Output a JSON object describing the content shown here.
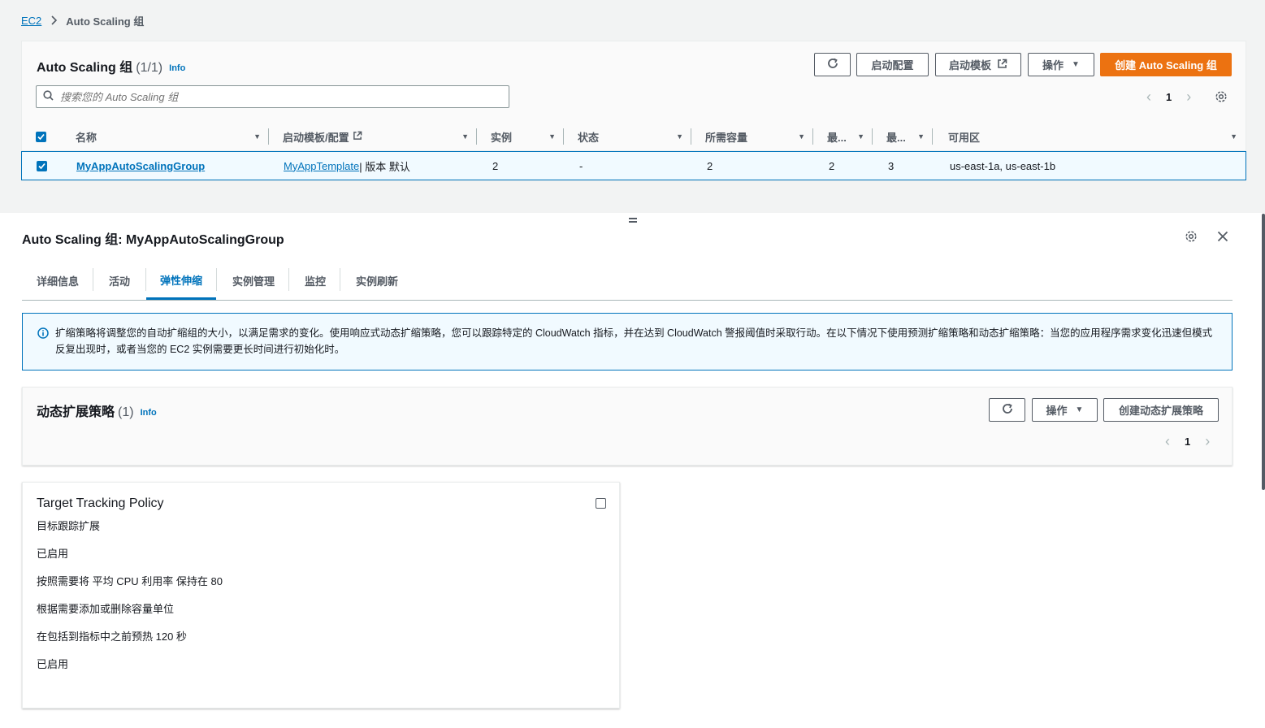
{
  "breadcrumb": {
    "root": "EC2",
    "current": "Auto Scaling 组"
  },
  "asg_panel": {
    "title": "Auto Scaling 组",
    "count": "(1/1)",
    "info": "Info",
    "buttons": {
      "launch_config": "启动配置",
      "launch_template": "启动模板",
      "actions": "操作",
      "create": "创建 Auto Scaling 组"
    },
    "search_placeholder": "搜索您的 Auto Scaling 组",
    "page": "1",
    "columns": [
      "名称",
      "启动模板/配置",
      "实例",
      "状态",
      "所需容量",
      "最...",
      "最...",
      "可用区"
    ],
    "row": {
      "name": "MyAppAutoScalingGroup",
      "template_link": "MyAppTemplate",
      "template_suffix": " | 版本 默认",
      "instances": "2",
      "status": "-",
      "desired": "2",
      "min": "2",
      "max": "3",
      "azs": "us-east-1a, us-east-1b"
    }
  },
  "detail": {
    "title": "Auto Scaling 组: MyAppAutoScalingGroup",
    "tabs": [
      "详细信息",
      "活动",
      "弹性伸缩",
      "实例管理",
      "监控",
      "实例刷新"
    ],
    "active_tab": "弹性伸缩",
    "alert": "扩缩策略将调整您的自动扩缩组的大小，以满足需求的变化。使用响应式动态扩缩策略，您可以跟踪特定的 CloudWatch 指标，并在达到 CloudWatch 警报阈值时采取行动。在以下情况下使用预测扩缩策略和动态扩缩策略：当您的应用程序需求变化迅速但模式反复出现时，或者当您的 EC2 实例需要更长时间进行初始化时。"
  },
  "policy_panel": {
    "title": "动态扩展策略",
    "count": "(1)",
    "info": "Info",
    "buttons": {
      "actions": "操作",
      "create": "创建动态扩展策略"
    },
    "page": "1"
  },
  "policy_card": {
    "title": "Target Tracking Policy",
    "lines": [
      "目标跟踪扩展",
      "已启用",
      "按照需要将 平均 CPU 利用率 保持在 80",
      "根据需要添加或删除容量单位",
      "在包括到指标中之前预热 120 秒",
      "已启用"
    ]
  },
  "colors": {
    "primary": "#ec7211",
    "link": "#0073bb",
    "alert_bg": "#f1faff"
  }
}
